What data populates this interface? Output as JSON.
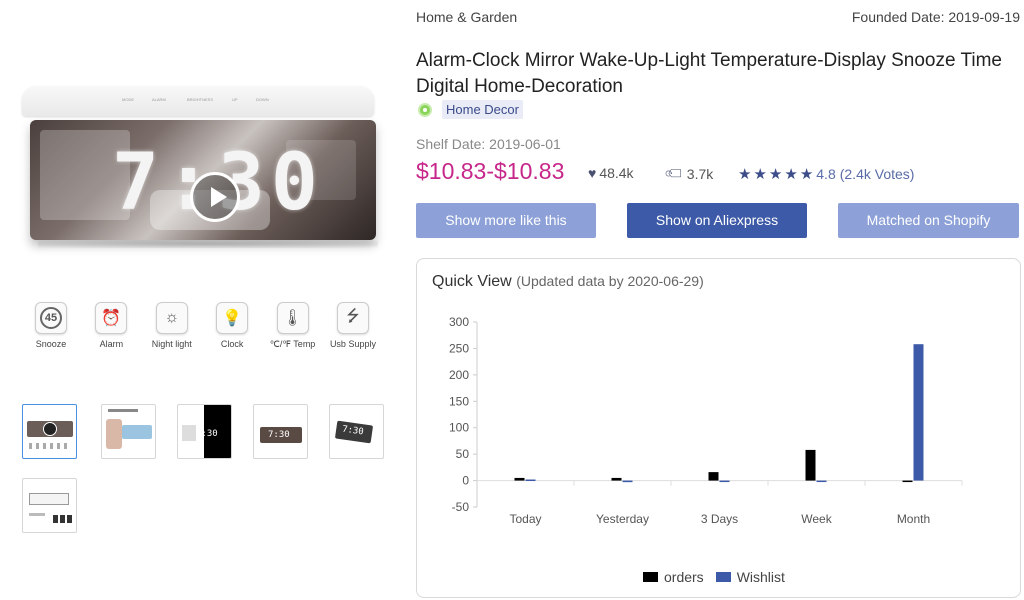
{
  "category": "Home & Garden",
  "founded_date": "Founded Date: 2019-09-19",
  "title": "Alarm-Clock Mirror Wake-Up-Light Temperature-Display Snooze Time Digital Home-Decoration",
  "tag": "Home Decor",
  "shelf_date": "Shelf Date: 2019-06-01",
  "price": "$10.83-$10.83",
  "likes": "48.4k",
  "orders_count": "3.7k",
  "rating": "4.8",
  "votes": "(2.4k Votes)",
  "main_image": {
    "display": "7:30",
    "top_labels": [
      "MODE",
      "ALARM",
      "BRIGHTNESS",
      "UP",
      "DOWN"
    ]
  },
  "buttons": {
    "more_like": "Show more like this",
    "aliexpress": "Show on Aliexpress",
    "shopify": "Matched on Shopify"
  },
  "features": [
    {
      "label": "Snooze",
      "icon": "snooze-icon",
      "glyph": "45"
    },
    {
      "label": "Alarm",
      "icon": "alarm-clock-icon",
      "glyph": "⏰"
    },
    {
      "label": "Night light",
      "icon": "night-light-icon",
      "glyph": "☼"
    },
    {
      "label": "Clock",
      "icon": "clock-light-icon",
      "glyph": "💡"
    },
    {
      "label": "℃/℉ Temp",
      "icon": "thermometer-icon",
      "glyph": "🌡"
    },
    {
      "label": "Usb Supply",
      "icon": "usb-icon",
      "glyph": "⭍"
    }
  ],
  "thumbnails": {
    "time_labels": [
      "7:30",
      "7:30",
      "7:30"
    ]
  },
  "quick_view": {
    "title": "Quick View",
    "subtitle": "(Updated data by 2020-06-29)"
  },
  "colors": {
    "orders": "#000000",
    "wishlist": "#3d5aa8",
    "price": "#c7278a",
    "accent": "#3d5aa8"
  },
  "chart_data": {
    "type": "bar",
    "categories": [
      "Today",
      "Yesterday",
      "3 Days",
      "Week",
      "Month"
    ],
    "series": [
      {
        "name": "orders",
        "values": [
          5,
          5,
          16,
          58,
          0
        ]
      },
      {
        "name": "Wishlist",
        "values": [
          2,
          -3,
          -2,
          0,
          258
        ]
      }
    ],
    "ylim": [
      -50,
      300
    ],
    "yticks": [
      300,
      250,
      200,
      150,
      100,
      50,
      0,
      -50
    ],
    "grid": false,
    "legend_position": "bottom"
  }
}
